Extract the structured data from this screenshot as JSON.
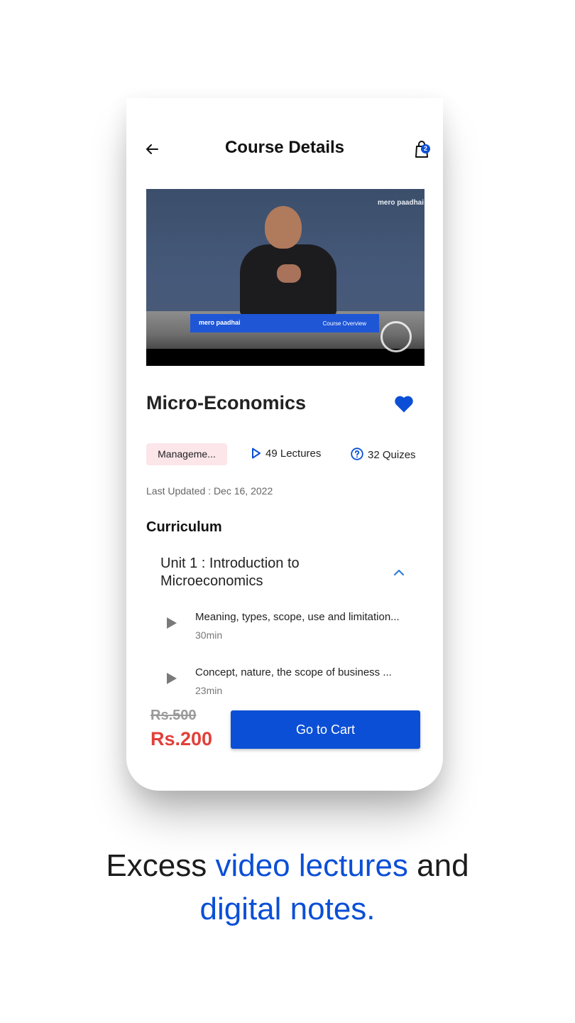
{
  "header": {
    "title": "Course Details",
    "cart_count": "2"
  },
  "video": {
    "watermark": "mero paadhai",
    "overlay_logo": "mero paadhai",
    "overlay_text": "Course Overview"
  },
  "course": {
    "title": "Micro-Economics",
    "category": "Manageme...",
    "lectures": "49 Lectures",
    "quizzes": "32 Quizes",
    "last_updated": "Last Updated : Dec 16, 2022"
  },
  "curriculum": {
    "heading": "Curriculum",
    "unit_title": "Unit 1 : Introduction to Microeconomics",
    "lessons": [
      {
        "title": "Meaning, types, scope, use and limitation...",
        "duration": "30min"
      },
      {
        "title": "Concept, nature, the scope of business ...",
        "duration": "23min"
      }
    ]
  },
  "pricing": {
    "original": "Rs.500",
    "current": "Rs.200",
    "cta": "Go to Cart"
  },
  "caption": {
    "part1": "Excess ",
    "highlight1": "video lectures",
    "part2": " and",
    "highlight2": "digital notes."
  },
  "colors": {
    "primary": "#0b4fd6",
    "price_red": "#e2403a",
    "tag_bg": "#fce6ea"
  }
}
